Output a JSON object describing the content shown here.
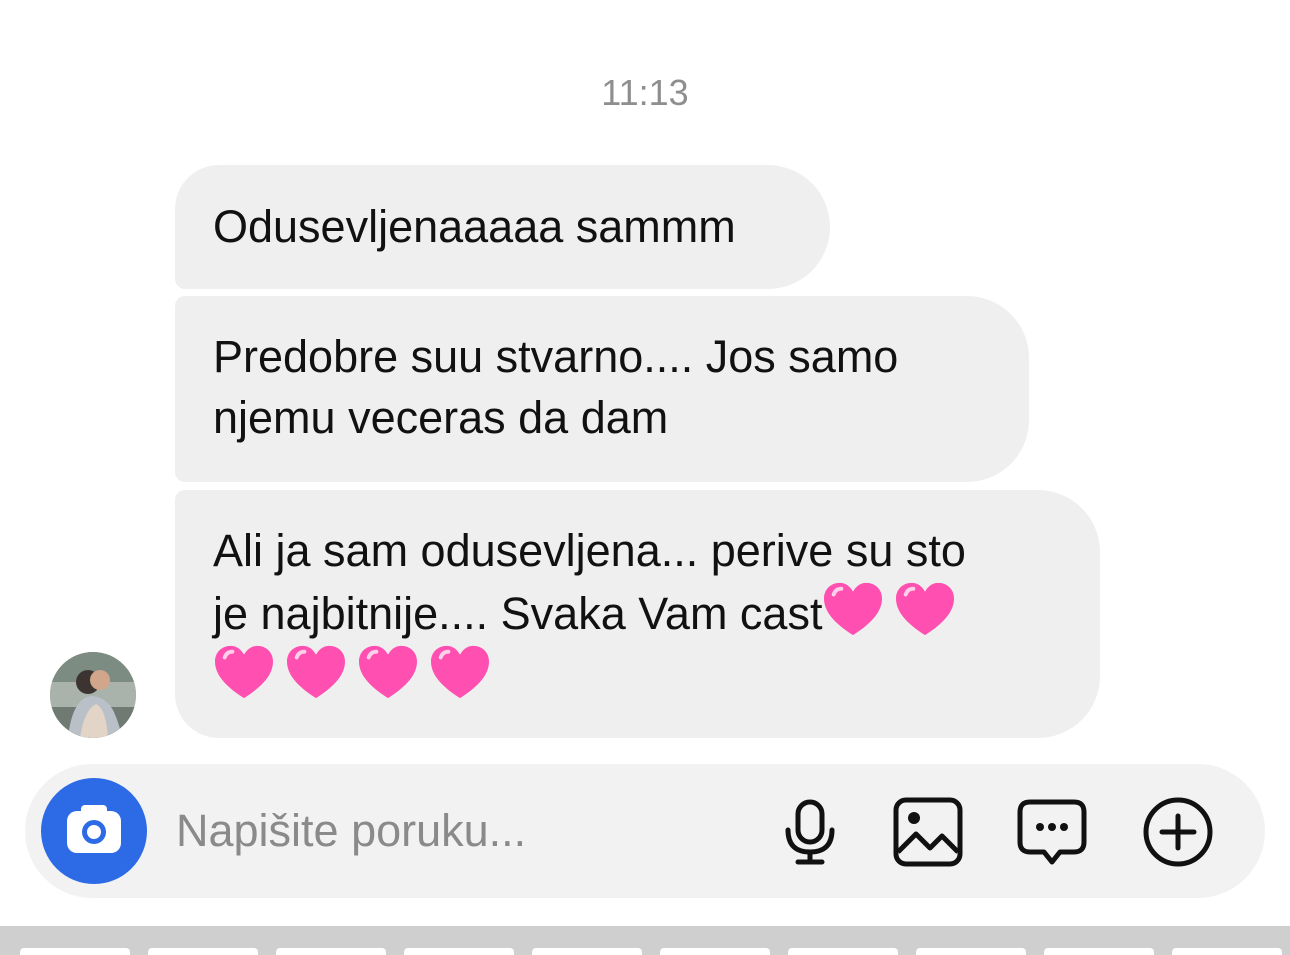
{
  "conversation": {
    "timestamp": "11:13",
    "messages": [
      {
        "text": "Odusevljenaaaaa sammm"
      },
      {
        "line1": "Predobre suu stvarno.... Jos samo",
        "line2": "njemu veceras da dam"
      },
      {
        "line1": "Ali ja sam odusevljena... perive su sto",
        "line2": "je najbitnije.... Svaka Vam cast",
        "emoji_count_line2": 2,
        "emoji_count_line3": 4,
        "emoji": "pink-heart"
      }
    ]
  },
  "composer": {
    "placeholder": "Napišite poruku...",
    "icons": [
      "camera-icon",
      "microphone-icon",
      "image-icon",
      "sticker-chat-icon",
      "plus-icon"
    ]
  },
  "colors": {
    "bubble": "#efefef",
    "camera_button": "#2d6be6",
    "timestamp": "#8e8e8e",
    "heart": "#ff4fb0"
  }
}
